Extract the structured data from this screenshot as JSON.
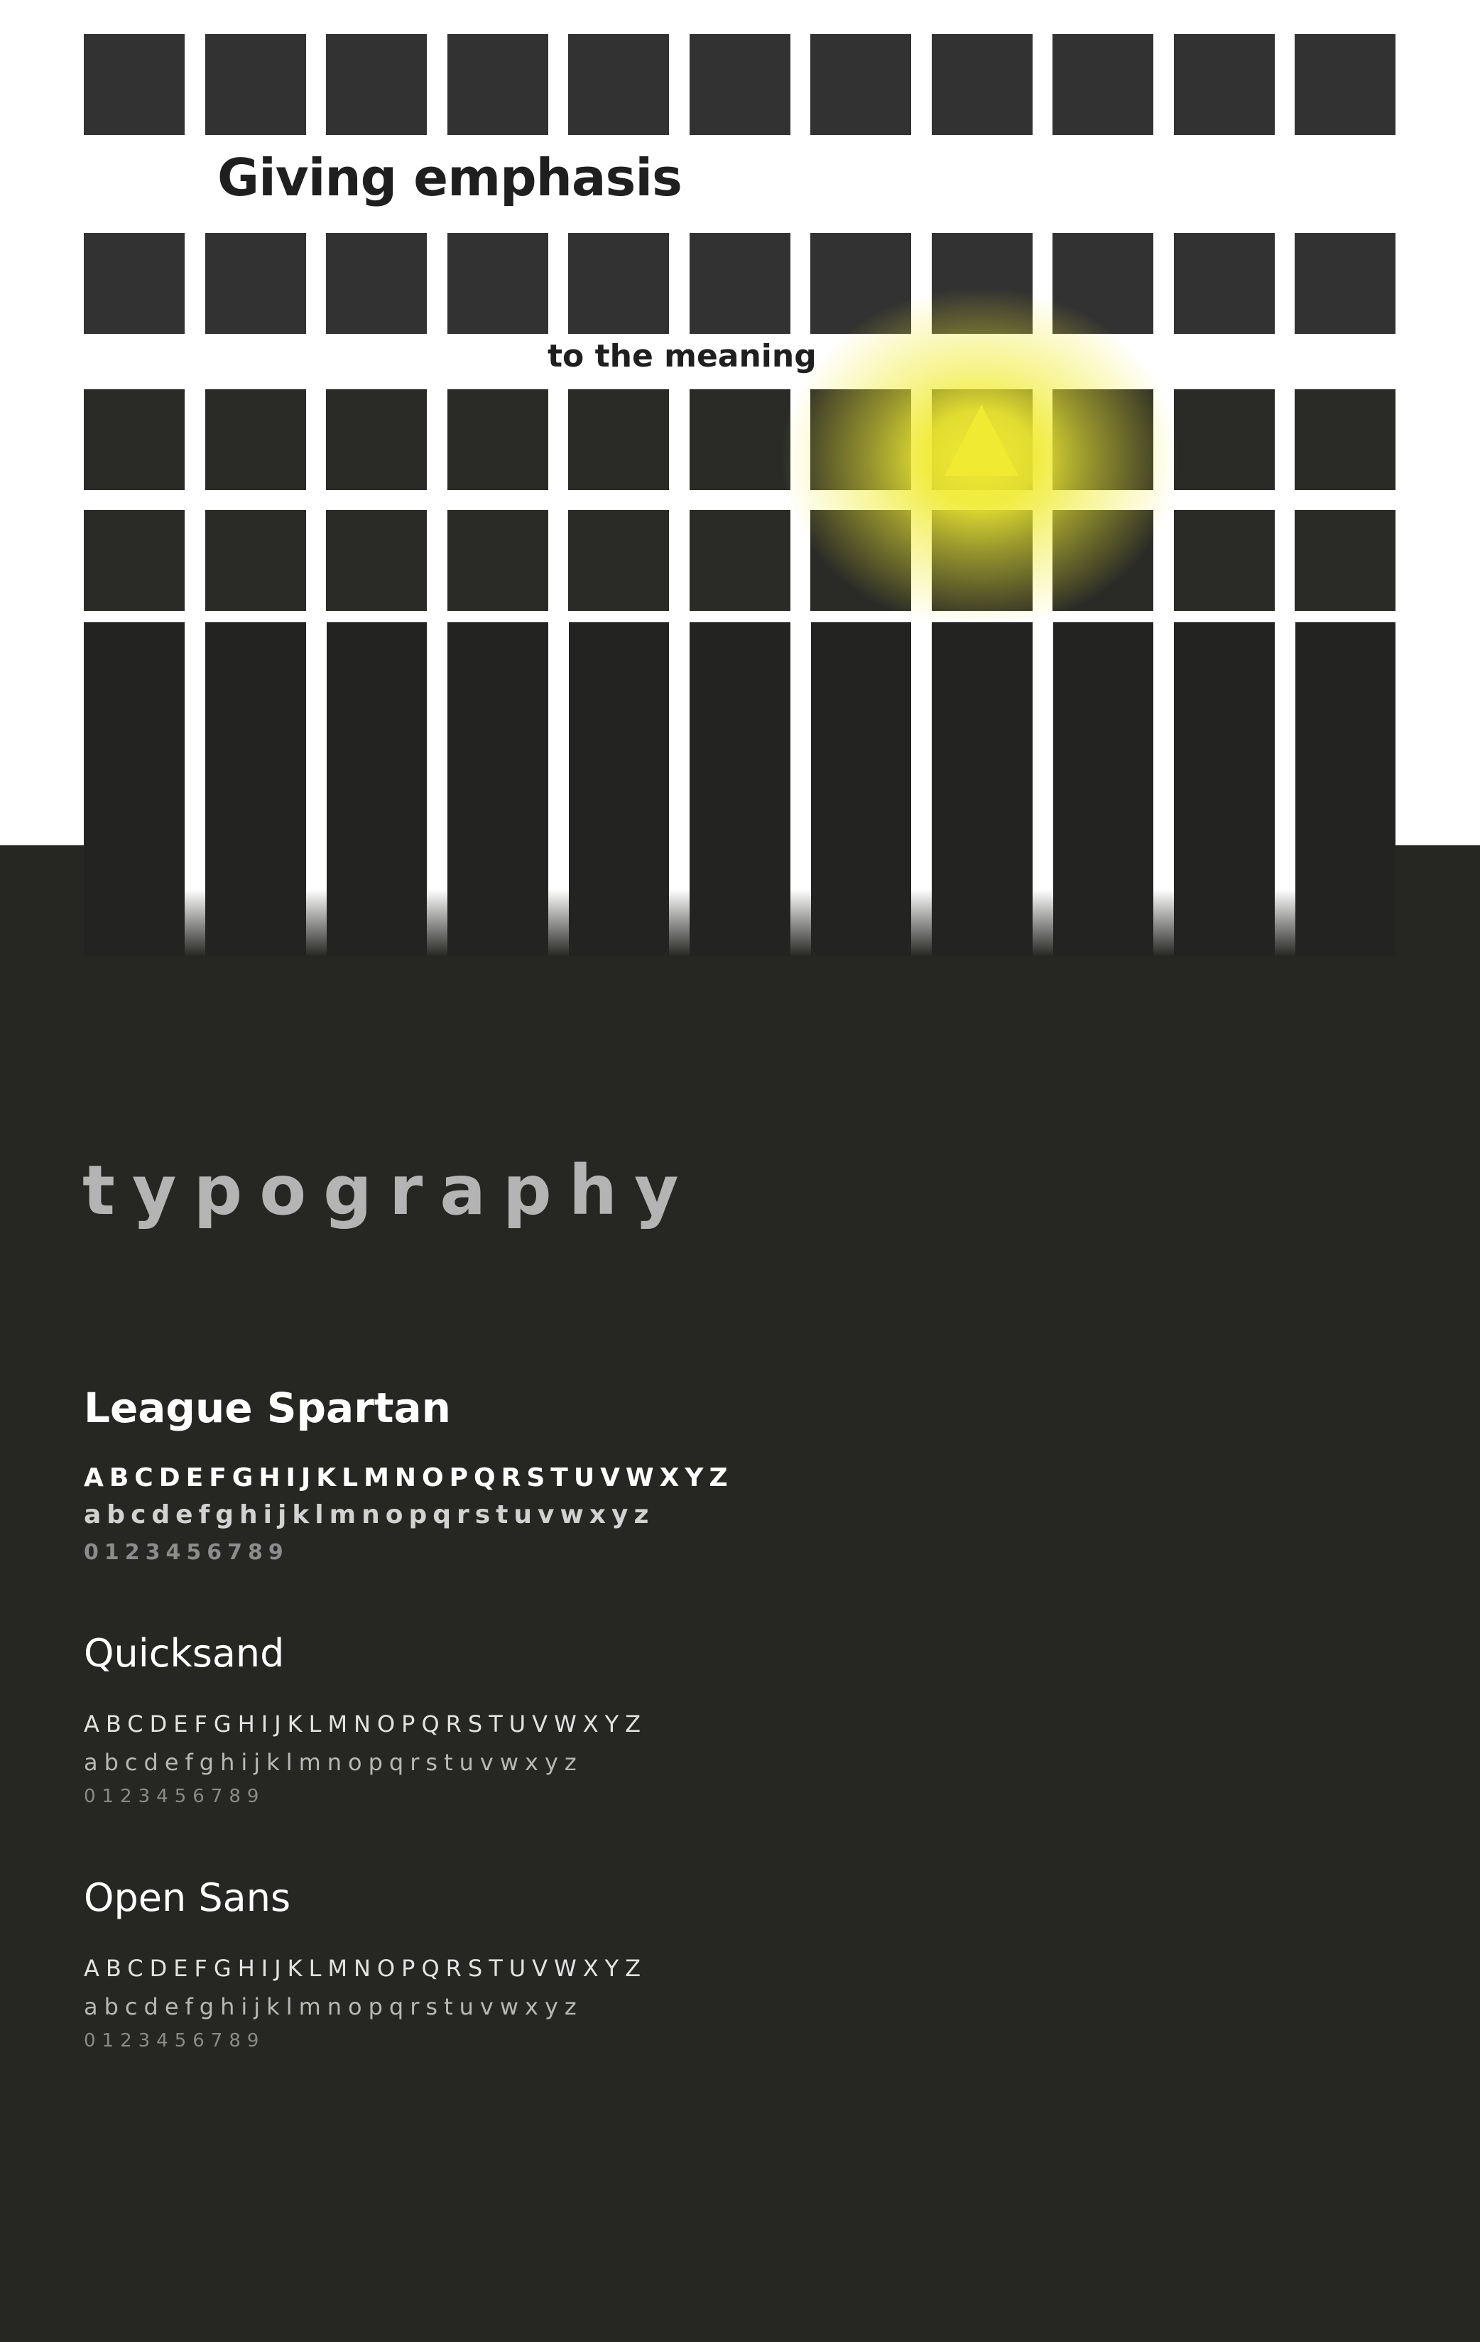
{
  "hero": {
    "headline": "Giving emphasis",
    "subline": "to the meaning",
    "accent_color": "#F0EB32",
    "tile_color": "#323232",
    "background_color": "#FFFFFF",
    "highlight_shape": "triangle-up-icon"
  },
  "section": {
    "title": "typography"
  },
  "fonts": [
    {
      "name": "League Spartan",
      "uppercase": "ABCDEFGHIJKLMNOPQRSTUVWXYZ",
      "lowercase": "abcdefghijklmnopqrstuvwxyz",
      "digits": "0123456789"
    },
    {
      "name": "Quicksand",
      "uppercase": "ABCDEFGHIJKLMNOPQRSTUVWXYZ",
      "lowercase": "abcdefghijklmnopqrstuvwxyz",
      "digits": "0123456789"
    },
    {
      "name": "Open Sans",
      "uppercase": "ABCDEFGHIJKLMNOPQRSTUVWXYZ",
      "lowercase": "abcdefghijklmnopqrstuvwxyz",
      "digits": "0123456789"
    }
  ],
  "colors": {
    "panel": "#262723",
    "title_gray": "#B4B4B4",
    "text_white": "#FFFFFF"
  }
}
